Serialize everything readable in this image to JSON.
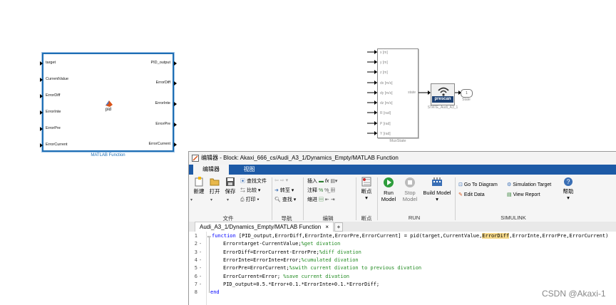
{
  "matlab_block": {
    "inputs": [
      "target",
      "CurrentValue",
      "ErrorDiff",
      "ErrorInte",
      "ErrorPre",
      "ErrorCurrent"
    ],
    "outputs": [
      "PID_output",
      "ErrorDiff",
      "ErrorInte",
      "ErrorPre",
      "ErrorCurrent"
    ],
    "center_label": "pid",
    "caption": "MATLAB Function"
  },
  "mux_block": {
    "inputs": [
      "x [m]",
      "y [m]",
      "z [m]",
      "dx [m/s]",
      "dy [m/s]",
      "dz [m/s]",
      "R [rad]",
      "P [rad]",
      "Y [rad]"
    ],
    "output": "state",
    "caption": "MuxState"
  },
  "prescan_block": {
    "logo": "prescan",
    "caption": "STATE_Audi_A3_1"
  },
  "outport": {
    "number": "1",
    "caption": "State"
  },
  "editor": {
    "title": "编辑器 - Block: Akaxi_666_cs/Audi_A3_1/Dynamics_Empty/MATLAB Function",
    "tabs": [
      "编辑器",
      "视图"
    ],
    "ribbon": {
      "new": "新建",
      "open": "打开",
      "save": "保存",
      "find_files": "查找文件",
      "compare": "比较",
      "print": "打印",
      "goto": "转至",
      "find": "查找",
      "insert": "插入",
      "comment": "注释",
      "indent": "缩进",
      "breakpoints": "断点",
      "run_model": "Run Model",
      "stop_model": "Stop Model",
      "build_model": "Build Model",
      "go_to_diagram": "Go To Diagram",
      "edit_data": "Edit Data",
      "simulation_target": "Simulation Target",
      "view_report": "View Report",
      "help": "帮助",
      "sections": {
        "file": "文件",
        "navigate": "导航",
        "edit": "编辑",
        "breakpoints": "断点",
        "run": "RUN",
        "simulink": "SIMULINK"
      }
    },
    "doc_tab": "Audi_A3_1/Dynamics_Empty/MATLAB Function",
    "add_tab": "+",
    "code": [
      {
        "n": "1",
        "dash": "",
        "t": "function [PID_output,ErrorDiff,ErrorInte,ErrorPre,ErrorCurrent] = pid(target,CurrentValue,ErrorDiff,ErrorInte,ErrorPre,ErrorCurrent)"
      },
      {
        "n": "2",
        "dash": "-",
        "t": "Error=target-CurrentValue;",
        "c": "%get divation"
      },
      {
        "n": "3",
        "dash": "-",
        "t": "ErrorDiff=ErrorCurrent-ErrorPre;",
        "c": "%diff divation"
      },
      {
        "n": "4",
        "dash": "-",
        "t": "ErrorInte=ErrorInte+Error;",
        "c": "%cumulated divation"
      },
      {
        "n": "5",
        "dash": "-",
        "t": "ErrorPre=ErrorCurrent;",
        "c": "%swith current divation to previous divation"
      },
      {
        "n": "6",
        "dash": "-",
        "t": "ErrorCurrent=Error; ",
        "c": "%save current divation"
      },
      {
        "n": "7",
        "dash": "-",
        "t": "PID_output=0.5.*Error+0.1.*ErrorInte+0.1.*ErrorDiff;"
      },
      {
        "n": "8",
        "dash": "",
        "t": "end"
      }
    ]
  },
  "watermark": "CSDN @Akaxi-1",
  "colors": {
    "tab_bar": "#1d5aa6",
    "block_border": "#1f6fb5",
    "keyword": "#0000ff",
    "comment": "#228b22",
    "highlight": "#f6d98a"
  }
}
